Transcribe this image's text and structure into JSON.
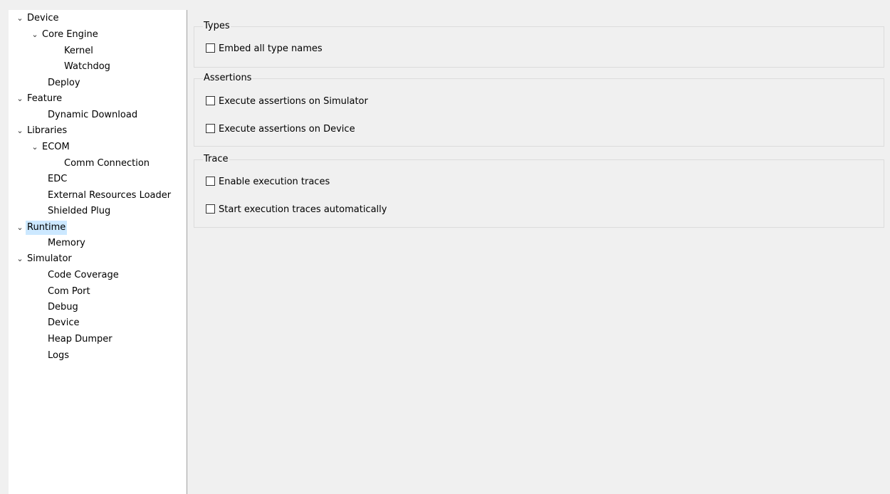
{
  "tree": {
    "items": [
      {
        "label": "Device",
        "chevron": "⌄"
      },
      {
        "label": "Core Engine",
        "chevron": "⌄"
      },
      {
        "label": "Kernel"
      },
      {
        "label": "Watchdog"
      },
      {
        "label": "Deploy"
      },
      {
        "label": "Feature",
        "chevron": "⌄"
      },
      {
        "label": "Dynamic Download"
      },
      {
        "label": "Libraries",
        "chevron": "⌄"
      },
      {
        "label": "ECOM",
        "chevron": "⌄"
      },
      {
        "label": "Comm Connection"
      },
      {
        "label": "EDC"
      },
      {
        "label": "External Resources Loader"
      },
      {
        "label": "Shielded Plug"
      },
      {
        "label": "Runtime",
        "chevron": "⌄",
        "selected": true
      },
      {
        "label": "Memory"
      },
      {
        "label": "Simulator",
        "chevron": "⌄"
      },
      {
        "label": "Code Coverage"
      },
      {
        "label": "Com Port"
      },
      {
        "label": "Debug"
      },
      {
        "label": "Device"
      },
      {
        "label": "Heap Dumper"
      },
      {
        "label": "Logs"
      }
    ],
    "selected_color": "#cce8ff"
  },
  "groups": {
    "types": {
      "title": "Types",
      "options": [
        {
          "label": "Embed all type names",
          "checked": false
        }
      ]
    },
    "assertions": {
      "title": "Assertions",
      "options": [
        {
          "label": "Execute assertions on Simulator",
          "checked": false
        },
        {
          "label": "Execute assertions on Device",
          "checked": false
        }
      ]
    },
    "trace": {
      "title": "Trace",
      "options": [
        {
          "label": "Enable execution traces",
          "checked": false
        },
        {
          "label": "Start execution traces automatically",
          "checked": false
        }
      ]
    }
  }
}
